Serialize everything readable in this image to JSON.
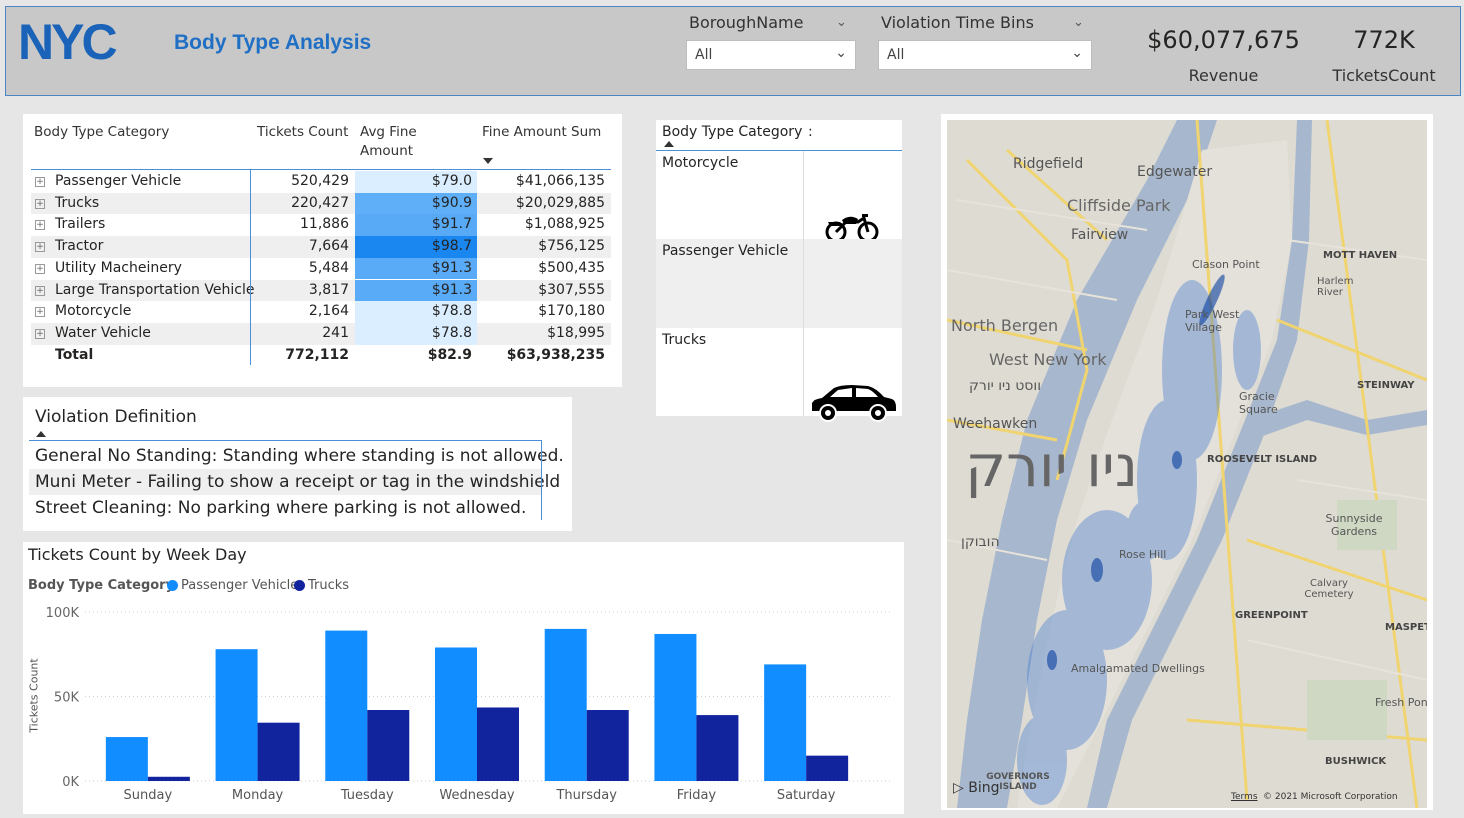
{
  "header": {
    "title": "Body Type Analysis",
    "logo_text": "NYC",
    "slicers": [
      {
        "label": "BoroughName",
        "value": "All"
      },
      {
        "label": "Violation Time Bins",
        "value": "All"
      }
    ],
    "kpis": [
      {
        "value": "$60,077,675",
        "label": "Revenue"
      },
      {
        "value": "772K",
        "label": "TicketsCount"
      }
    ]
  },
  "body_table": {
    "headers": [
      "Body Type Category",
      "Tickets Count",
      "Avg Fine",
      "Amount",
      "Fine Amount Sum"
    ],
    "rows": [
      {
        "category": "Passenger Vehicle",
        "count": "520,429",
        "avg": "$79.0",
        "sum": "$41,066,135",
        "avg_color": "#dbeeff"
      },
      {
        "category": "Trucks",
        "count": "220,427",
        "avg": "$90.9",
        "sum": "$20,029,885",
        "avg_color": "#5eaef8"
      },
      {
        "category": "Trailers",
        "count": "11,886",
        "avg": "$91.7",
        "sum": "$1,088,925",
        "avg_color": "#58a9f6"
      },
      {
        "category": "Tractor",
        "count": "7,664",
        "avg": "$98.7",
        "sum": "$756,125",
        "avg_color": "#1a86f0"
      },
      {
        "category": "Utility Macheinery",
        "count": "5,484",
        "avg": "$91.3",
        "sum": "$500,435",
        "avg_color": "#5aabf7"
      },
      {
        "category": "Large Transportation Vehicle",
        "count": "3,817",
        "avg": "$91.3",
        "sum": "$307,555",
        "avg_color": "#5aabf7"
      },
      {
        "category": "Motorcycle",
        "count": "2,164",
        "avg": "$78.8",
        "sum": "$170,180",
        "avg_color": "#dbeeff"
      },
      {
        "category": "Water Vehicle",
        "count": "241",
        "avg": "$78.8",
        "sum": "$18,995",
        "avg_color": "#dbeeff"
      }
    ],
    "total": {
      "label": "Total",
      "count": "772,112",
      "avg": "$82.9",
      "sum": "$63,938,235"
    }
  },
  "violation_definition": {
    "header": "Violation Definition",
    "items": [
      "General No Standing: Standing where standing is not allowed.",
      "Muni Meter - Failing to show a receipt or tag in the windshield",
      "Street Cleaning: No parking where parking is not allowed."
    ]
  },
  "image_table": {
    "headers": [
      "Body Type Category",
      ":"
    ],
    "rows": [
      {
        "category": "Motorcycle",
        "icon": "motorcycle-icon"
      },
      {
        "category": "Passenger Vehicle",
        "icon": "car-icon"
      },
      {
        "category": "Trucks",
        "icon": "truck-icon"
      }
    ]
  },
  "chart_data": {
    "type": "bar",
    "title": "Tickets Count by Week Day",
    "legend_title": "Body Type Category",
    "legend_position": "top-left",
    "ylabel": "Tickets Count",
    "xlabel": "",
    "categories": [
      "Sunday",
      "Monday",
      "Tuesday",
      "Wednesday",
      "Thursday",
      "Friday",
      "Saturday"
    ],
    "series": [
      {
        "name": "Passenger Vehicle",
        "color": "#118dff",
        "values": [
          26000,
          78000,
          89000,
          79000,
          90000,
          87000,
          69000
        ]
      },
      {
        "name": "Trucks",
        "color": "#12239e",
        "values": [
          2500,
          34500,
          42000,
          43500,
          42000,
          39000,
          15000
        ]
      }
    ],
    "yticks": [
      "0K",
      "50K",
      "100K"
    ],
    "ylim": [
      0,
      100000
    ],
    "grid": true
  },
  "map": {
    "labels": {
      "ridgefield": "Ridgefield",
      "edgewater": "Edgewater",
      "cliffside": "Cliffside Park",
      "fairview": "Fairview",
      "north_bergen": "North Bergen",
      "west_ny": "West New York",
      "west_ny_heb": "ווסט ניו יורק",
      "weehawken": "Weehawken",
      "hoboken_heb": "הובוקן",
      "ny_heb": "ניו יורק",
      "mott_haven": "MOTT HAVEN",
      "harlem_river": "Harlem River",
      "steinway": "STEINWAY",
      "roosevelt": "ROOSEVELT ISLAND",
      "sunnyside": "Sunnyside Gardens",
      "rose_hill": "Rose Hill",
      "calvary": "Calvary Cemetery",
      "greenpoint": "GREENPOINT",
      "maspeth": "MASPETH",
      "amalgamated": "Amalgamated Dwellings",
      "fresh_pond": "Fresh Pon",
      "bushwick": "BUSHWICK",
      "governors": "GOVERNORS ISLAND",
      "gracie": "Gracie Square",
      "park_west": "Park West Village",
      "clason": "Clason Point"
    },
    "bing_label": "Bing",
    "terms_label": "Terms",
    "copyright": "© 2021 Microsoft Corporation"
  }
}
